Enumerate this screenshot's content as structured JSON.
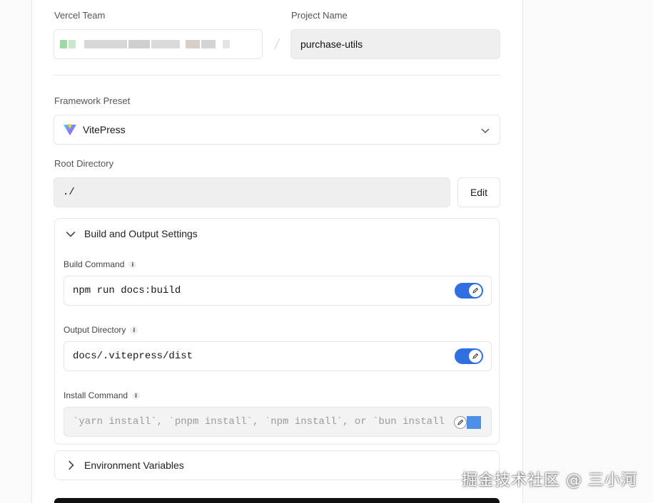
{
  "team": {
    "label": "Vercel Team"
  },
  "project": {
    "label": "Project Name",
    "value": "purchase-utils"
  },
  "separator": "/",
  "framework": {
    "label": "Framework Preset",
    "value": "VitePress"
  },
  "root": {
    "label": "Root Directory",
    "value": "./",
    "edit_label": "Edit"
  },
  "build_section": {
    "title": "Build and Output Settings",
    "build_command": {
      "label": "Build Command",
      "value": "npm run docs:build",
      "override": true
    },
    "output_directory": {
      "label": "Output Directory",
      "value": "docs/.vitepress/dist",
      "override": true
    },
    "install_command": {
      "label": "Install Command",
      "placeholder": "`yarn install`, `pnpm install`, `npm install`, or `bun install`",
      "override": false
    }
  },
  "env_section": {
    "title": "Environment Variables"
  },
  "watermark": "掘金技术社区 @ 三小河",
  "colors": {
    "toggle_on": "#2f6fe0",
    "accent_purple": "#8b5cf6",
    "accent_yellow": "#facc15"
  }
}
